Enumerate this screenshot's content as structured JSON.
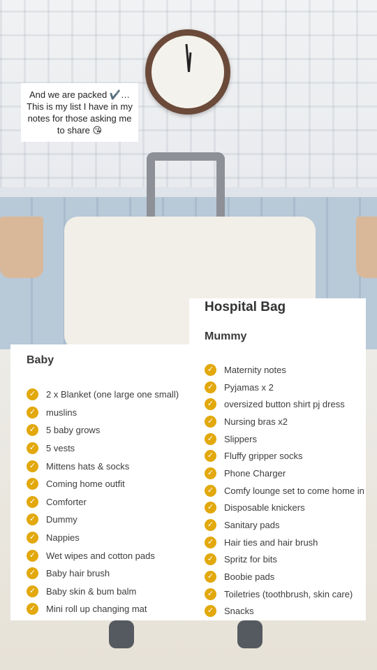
{
  "caption": {
    "text": "And we are packed ✔️… This is my list I have in my notes for those asking me to share 😘"
  },
  "accent_color": "#e2a80c",
  "check_icon": "checkmark-circle-icon",
  "baby": {
    "heading": "Baby",
    "items": [
      "2 x Blanket (one large one small)",
      "muslins",
      "5 baby grows",
      "5 vests",
      "Mittens hats & socks",
      "Coming home outfit",
      "Comforter",
      "Dummy",
      "Nappies",
      "Wet wipes and cotton pads",
      "Baby hair brush",
      "Baby skin & bum balm",
      "Mini roll up changing mat"
    ]
  },
  "hospital": {
    "title": "Hospital Bag",
    "heading": "Mummy",
    "items": [
      "Maternity notes",
      "Pyjamas x 2",
      "oversized button shirt pj dress",
      "Nursing bras x2",
      "Slippers",
      "Fluffy gripper socks",
      "Phone Charger",
      "Comfy lounge set to come home in",
      "Disposable knickers",
      "Sanitary pads",
      "Hair ties and hair brush",
      "Spritz for bits",
      "Boobie pads",
      "Toiletries (toothbrush, skin care)",
      "Snacks"
    ]
  }
}
